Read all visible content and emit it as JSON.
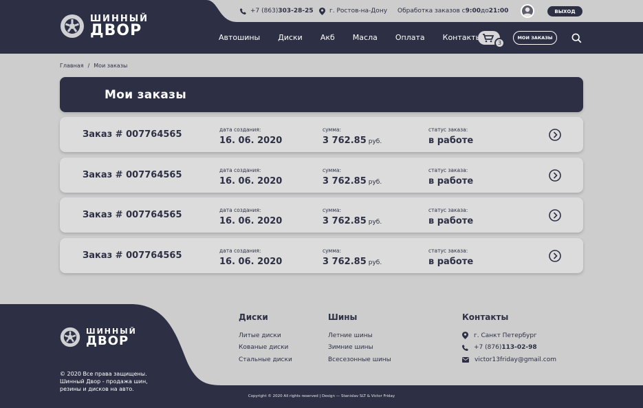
{
  "brand": {
    "line1": "ШИННЫЙ",
    "line2": "ДВОР"
  },
  "topbar": {
    "phone_prefix": "+7 (863) ",
    "phone_main": "303-28-25",
    "city": "г. Ростов-на-Дону",
    "hours_prefix": "Обработка заказов с ",
    "hours_from": "9:00",
    "hours_mid": " до ",
    "hours_to": "21:00",
    "logout": "ВЫХОД"
  },
  "nav": {
    "items": [
      "Автошины",
      "Диски",
      "Акб",
      "Масла",
      "Оплата",
      "Контакты"
    ]
  },
  "cart": {
    "count": "3"
  },
  "my_orders_btn": "МОИ ЗАКАЗЫ",
  "breadcrumb": {
    "home": "Главная",
    "sep": "/",
    "current": "Мои заказы"
  },
  "page": {
    "title": "Мои заказы"
  },
  "orders": {
    "labels": {
      "date": "дата создания:",
      "sum": "сумма:",
      "status": "статус заказа:"
    },
    "items": [
      {
        "number": "Заказ # 007764565",
        "date": "16. 06. 2020",
        "sum": "3 762.85",
        "currency": "руб.",
        "status": "в работе"
      },
      {
        "number": "Заказ # 007764565",
        "date": "16. 06. 2020",
        "sum": "3 762.85",
        "currency": "руб.",
        "status": "в работе"
      },
      {
        "number": "Заказ # 007764565",
        "date": "16. 06. 2020",
        "sum": "3 762.85",
        "currency": "руб.",
        "status": "в работе"
      },
      {
        "number": "Заказ # 007764565",
        "date": "16. 06. 2020",
        "sum": "3 762.85",
        "currency": "руб.",
        "status": "в работе"
      }
    ]
  },
  "footer": {
    "copyright_left": "© 2020 Все права защищены. Шинный Двор - продажа шин, резины и дисков на авто.",
    "disks": {
      "title": "Диски",
      "items": [
        "Литые диски",
        "Кованые диски",
        "Стальные диски"
      ]
    },
    "tires": {
      "title": "Шины",
      "items": [
        "Летние шины",
        "Зимние шины",
        "Всесезонные шины"
      ]
    },
    "contacts": {
      "title": "Контакты",
      "city": "г. Санкт Петербург",
      "phone_prefix": "+7 (876) ",
      "phone_main": "113-02-98",
      "email": "victor13friday@gmail.com"
    },
    "copyright_bottom": "Copyright © 2020 All rights reserved | Design — Stanislav SLT & Victor Friday"
  },
  "colors": {
    "dark": "#2d3044",
    "background": "#cdcdce",
    "card": "#dcdcdd"
  }
}
